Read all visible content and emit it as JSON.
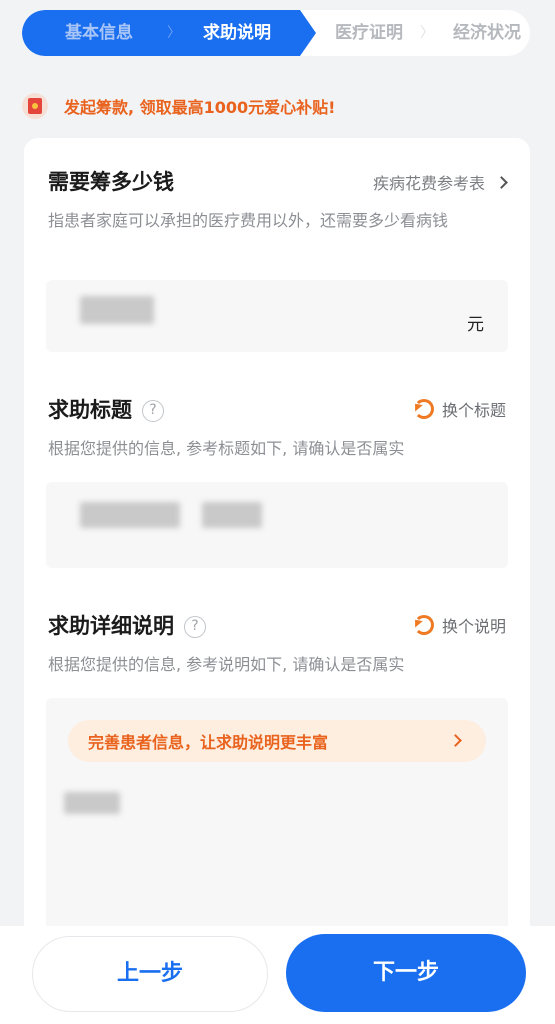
{
  "steps": [
    {
      "label": "基本信息",
      "state": "done"
    },
    {
      "label": "求助说明",
      "state": "active"
    },
    {
      "label": "医疗证明",
      "state": "pending"
    },
    {
      "label": "经济状况",
      "state": "pending"
    }
  ],
  "notice": {
    "icon": "red-packet-icon",
    "text": "发起筹款, 领取最高1000元爱心补贴!"
  },
  "amount": {
    "title": "需要筹多少钱",
    "reference_link": "疾病花费参考表",
    "description": "指患者家庭可以承担的医疗费用以外，还需要多少看病钱",
    "unit": "元"
  },
  "help_title": {
    "title": "求助标题",
    "help_icon_text": "?",
    "action": "换个标题",
    "description": "根据您提供的信息, 参考标题如下, 请确认是否属实"
  },
  "help_detail": {
    "title": "求助详细说明",
    "help_icon_text": "?",
    "action": "换个说明",
    "description": "根据您提供的信息, 参考说明如下, 请确认是否属实",
    "tip": "完善患者信息，让求助说明更丰富"
  },
  "footer": {
    "prev_label": "上一步",
    "next_label": "下一步"
  },
  "colors": {
    "primary": "#1a6ff0",
    "accent": "#e9631e"
  }
}
